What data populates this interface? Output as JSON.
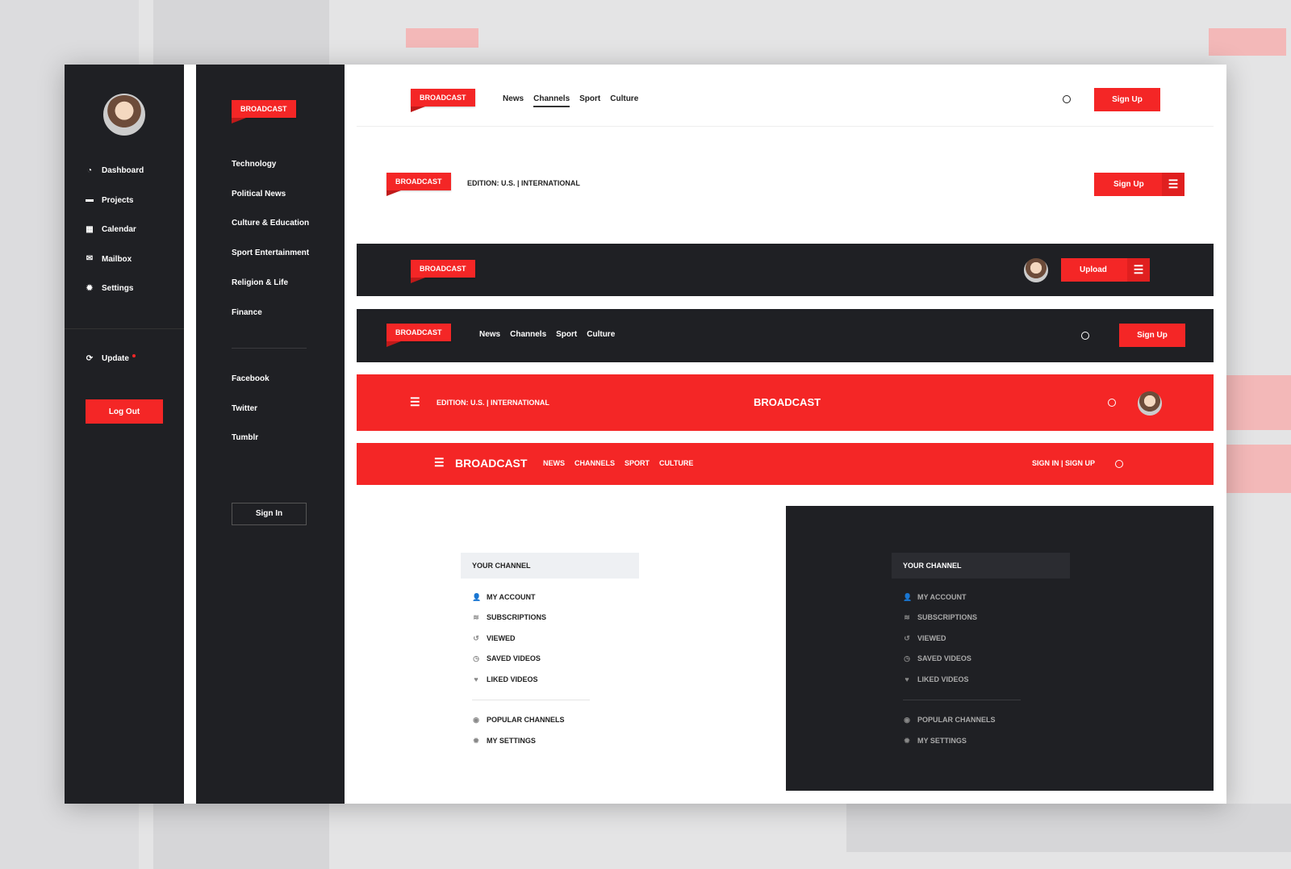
{
  "sidebar": {
    "items": [
      {
        "label": "Dashboard",
        "icon": "dashboard-icon",
        "glyph": "◔"
      },
      {
        "label": "Projects",
        "icon": "folder-icon",
        "glyph": "▬"
      },
      {
        "label": "Calendar",
        "icon": "calendar-icon",
        "glyph": "▦"
      },
      {
        "label": "Mailbox",
        "icon": "mail-icon",
        "glyph": "✉"
      },
      {
        "label": "Settings",
        "icon": "gear-icon",
        "glyph": "✹"
      }
    ],
    "update_label": "Update",
    "logout_label": "Log Out"
  },
  "categories": {
    "logo": "BROADCAST",
    "items": [
      "Technology",
      "Political News",
      "Culture & Education",
      "Sport Entertainment",
      "Religion & Life",
      "Finance"
    ],
    "social": [
      "Facebook",
      "Twitter",
      "Tumblr"
    ],
    "signin_label": "Sign In"
  },
  "headers": {
    "logo": "BROADCAST",
    "nav": [
      "News",
      "Channels",
      "Sport",
      "Culture"
    ],
    "nav_caps": [
      "NEWS",
      "CHANNELS",
      "SPORT",
      "CULTURE"
    ],
    "active_nav": "Channels",
    "edition": "EDITION: U.S. | INTERNATIONAL",
    "signup_label": "Sign Up",
    "upload_label": "Upload",
    "signin_signup": "SIGN IN | SIGN UP"
  },
  "channel": {
    "title": "YOUR CHANNEL",
    "items": [
      {
        "label": "MY ACCOUNT",
        "glyph": "👤"
      },
      {
        "label": "SUBSCRIPTIONS",
        "glyph": "≋"
      },
      {
        "label": "VIEWED",
        "glyph": "↺"
      },
      {
        "label": "SAVED VIDEOS",
        "glyph": "◷"
      },
      {
        "label": "LIKED VIDEOS",
        "glyph": "♥"
      }
    ],
    "extra": [
      {
        "label": "POPULAR CHANNELS",
        "glyph": "◉"
      },
      {
        "label": "MY SETTINGS",
        "glyph": "✹"
      }
    ]
  },
  "colors": {
    "accent": "#f42626",
    "dark": "#1f2024"
  }
}
